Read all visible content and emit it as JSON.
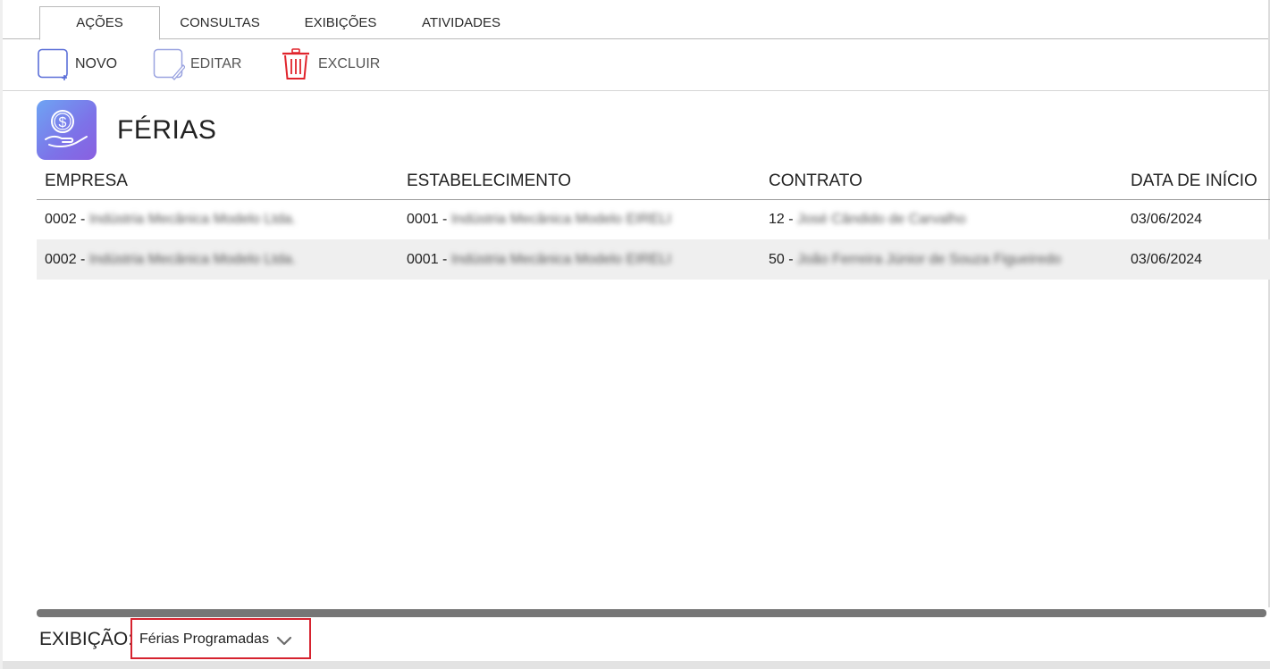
{
  "tabs": [
    {
      "label": "AÇÕES",
      "active": true
    },
    {
      "label": "CONSULTAS",
      "active": false
    },
    {
      "label": "EXIBIÇÕES",
      "active": false
    },
    {
      "label": "ATIVIDADES",
      "active": false
    }
  ],
  "toolbar": {
    "new_label": "NOVO",
    "edit_label": "EDITAR",
    "delete_label": "EXCLUIR",
    "new_icon": "new-document-icon",
    "edit_icon": "edit-document-icon",
    "delete_icon": "trash-icon"
  },
  "header": {
    "title": "FÉRIAS",
    "icon": "money-hand-icon"
  },
  "table": {
    "columns": [
      "EMPRESA",
      "ESTABELECIMENTO",
      "CONTRATO",
      "DATA DE INÍCIO"
    ],
    "rows": [
      {
        "empresa_code": "0002 -",
        "empresa_name": "Indústria Mecânica Modelo Ltda.",
        "estab_code": "0001 -",
        "estab_name": "Indústria Mecânica Modelo EIRELI",
        "contrato_code": "12 -",
        "contrato_name": "José Cândido de Carvalho",
        "data_inicio": "03/06/2024"
      },
      {
        "empresa_code": "0002 -",
        "empresa_name": "Indústria Mecânica Modelo Ltda.",
        "estab_code": "0001 -",
        "estab_name": "Indústria Mecânica Modelo EIRELI",
        "contrato_code": "50 -",
        "contrato_name": "João Ferreira Júnior de Souza Figueiredo",
        "data_inicio": "03/06/2024"
      }
    ]
  },
  "display": {
    "label": "EXIBIÇÃO:",
    "selected": "Férias Programadas"
  },
  "colors": {
    "accent_highlight": "#d6232f",
    "delete_icon": "#e0242c",
    "doc_icon": "#5b6fd8"
  }
}
